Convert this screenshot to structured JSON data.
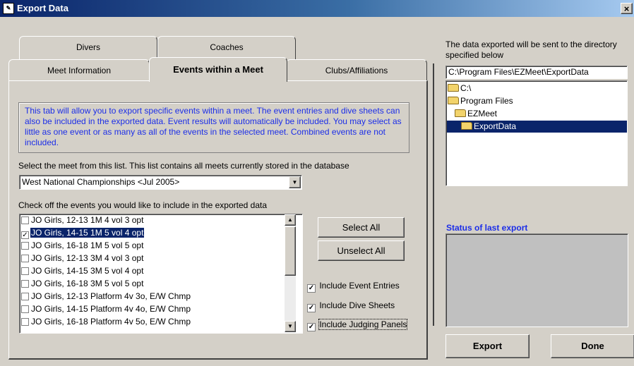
{
  "window": {
    "title": "Export Data",
    "close_glyph": "×",
    "icon": "app-icon"
  },
  "tabs": {
    "row1": [
      "Divers",
      "Coaches"
    ],
    "row2": [
      "Meet Information",
      "Events within a Meet",
      "Clubs/Affiliations"
    ],
    "active": "Events within a Meet"
  },
  "info_text": "This tab will allow you to export specific events within a meet. The event entries and dive sheets can also be included in the exported data. Event results will automatically be included. You may select as little as one event or as many as all of the events in the selected meet. Combined events are not included.",
  "meet_select": {
    "label": "Select the meet from this list. This list contains all meets currently stored in the database",
    "value": "West National Championships <Jul 2005>"
  },
  "events": {
    "label": "Check off the events you would like to include in the exported data",
    "items": [
      {
        "label": "JO Girls, 12-13 1M 4 vol 3 opt",
        "checked": false,
        "selected": false
      },
      {
        "label": "JO Girls, 14-15 1M 5 vol 4 opt",
        "checked": true,
        "selected": true
      },
      {
        "label": "JO Girls, 16-18 1M 5 vol 5 opt",
        "checked": false,
        "selected": false
      },
      {
        "label": "JO Girls, 12-13 3M 4 vol 3 opt",
        "checked": false,
        "selected": false
      },
      {
        "label": "JO Girls, 14-15 3M 5 vol 4 opt",
        "checked": false,
        "selected": false
      },
      {
        "label": "JO Girls, 16-18 3M 5 vol 5 opt",
        "checked": false,
        "selected": false
      },
      {
        "label": "JO Girls, 12-13 Platform 4v 3o, E/W Chmp",
        "checked": false,
        "selected": false
      },
      {
        "label": "JO Girls, 14-15 Platform 4v 4o, E/W Chmp",
        "checked": false,
        "selected": false
      },
      {
        "label": "JO Girls, 16-18 Platform 4v 5o, E/W Chmp",
        "checked": false,
        "selected": false
      }
    ]
  },
  "buttons": {
    "select_all": "Select All",
    "unselect_all": "Unselect All",
    "export": "Export",
    "done": "Done"
  },
  "options": [
    {
      "label": "Include Event Entries",
      "checked": true
    },
    {
      "label": "Include Dive Sheets",
      "checked": true
    },
    {
      "label": "Include Judging Panels",
      "checked": true
    }
  ],
  "directory": {
    "label": "The data exported will be sent to the directory specified below",
    "path": "C:\\Program Files\\EZMeet\\ExportData",
    "tree": [
      {
        "label": "C:\\",
        "selected": false
      },
      {
        "label": "Program Files",
        "selected": false
      },
      {
        "label": "EZMeet",
        "selected": false
      },
      {
        "label": "ExportData",
        "selected": true
      }
    ]
  },
  "status": {
    "label": "Status of last export",
    "text": ""
  }
}
